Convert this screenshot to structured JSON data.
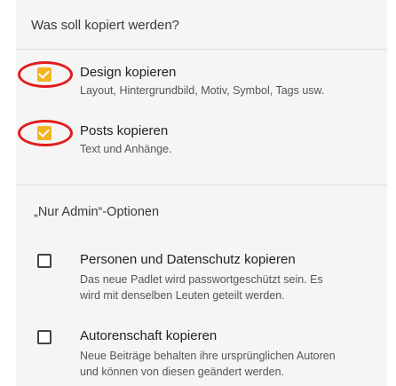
{
  "header": {
    "title": "Was soll kopiert werden?"
  },
  "options": [
    {
      "title": "Design kopieren",
      "desc": "Layout, Hintergrundbild, Motiv, Symbol, Tags usw.",
      "checked": true
    },
    {
      "title": "Posts kopieren",
      "desc": "Text und Anhänge.",
      "checked": true
    }
  ],
  "admin": {
    "title": "„Nur Admin“-Optionen",
    "options": [
      {
        "title": "Personen und Datenschutz kopieren",
        "desc_line1": "Das neue Padlet wird passwortgeschützt sein. Es",
        "desc_line2": "wird mit denselben Leuten geteilt werden.",
        "checked": false
      },
      {
        "title": "Autorenschaft kopieren",
        "desc_line1": "Neue Beiträge behalten ihre ursprünglichen Autoren",
        "desc_line2": "und können von diesen geändert werden.",
        "checked": false
      }
    ]
  },
  "colors": {
    "accent": "#f2b51f",
    "highlight_ring": "#e11d1d",
    "panel": "#f5f5f5"
  }
}
